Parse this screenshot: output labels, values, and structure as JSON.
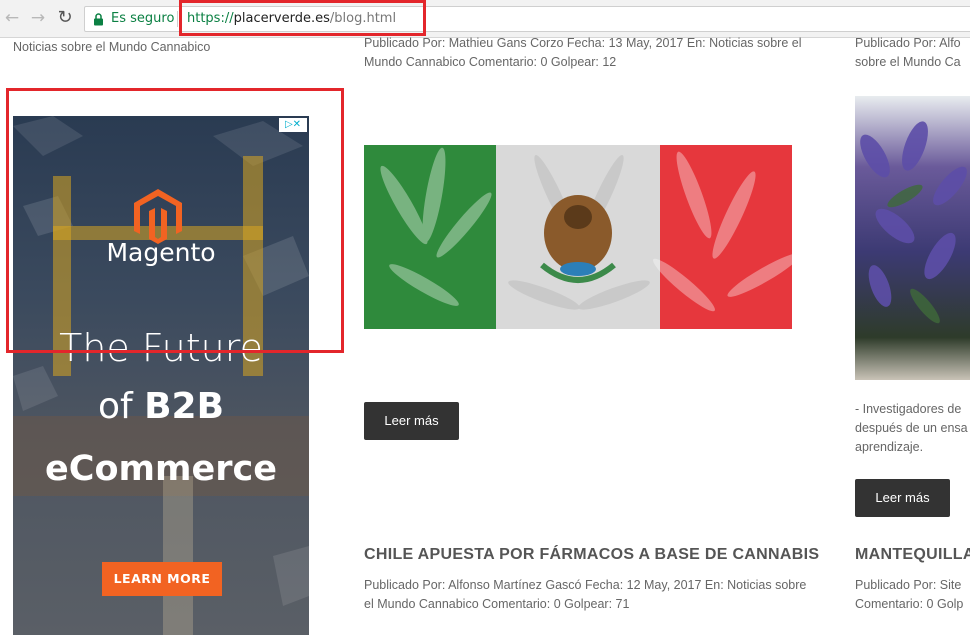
{
  "browser": {
    "secure_label": "Es seguro",
    "url_protocol": "https://",
    "url_host": "placerverde.es",
    "url_path": "/blog.html"
  },
  "left_column": {
    "category_text": "Noticias sobre el Mundo Cannabico"
  },
  "ad": {
    "adchoices": "▷✕",
    "brand": "Magento",
    "headline_line1": "The Future",
    "headline_line2_prefix": "of",
    "headline_line2_bold": "B2B",
    "headline_line3": "eCommerce",
    "cta": "LEARN MORE",
    "colors": {
      "cta": "#f26322",
      "logo": "#f26322"
    }
  },
  "articles": [
    {
      "meta": "Publicado Por: Mathieu Gans Corzo Fecha: 13 May, 2017 En: Noticias sobre el Mundo Cannabico Comentario: 0 Golpear: 12",
      "button": "Leer más"
    },
    {
      "meta": "Publicado Por: Alfo sobre el Mundo Ca",
      "excerpt": "- Investigadores de después de un ensa aprendizaje.",
      "button": "Leer más"
    },
    {
      "title": "CHILE APUESTA POR FÁRMACOS A BASE DE CANNABIS",
      "meta": "Publicado Por: Alfonso Martínez Gascó Fecha: 12 May, 2017 En: Noticias sobre el Mundo Cannabico Comentario: 0 Golpear: 71"
    },
    {
      "title": "MANTEQUILLA",
      "meta": "Publicado Por: Site Comentario: 0 Golp"
    }
  ],
  "highlight_color": "#e3262b"
}
